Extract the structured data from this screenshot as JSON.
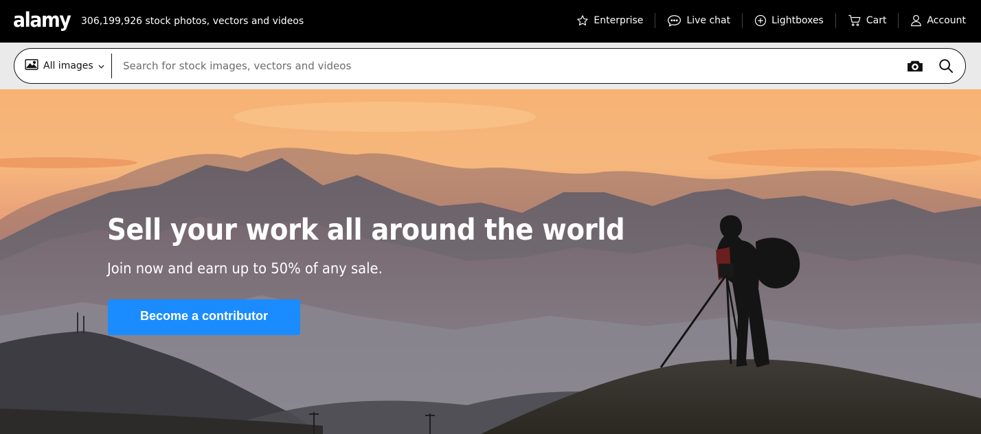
{
  "brand": {
    "logo_text": "alamy",
    "tagline": "306,199,926 stock photos, vectors and videos"
  },
  "topnav": {
    "items": [
      {
        "label": "Enterprise",
        "icon": "star-icon"
      },
      {
        "label": "Live chat",
        "icon": "chat-bubble-icon"
      },
      {
        "label": "Lightboxes",
        "icon": "plus-circle-icon"
      },
      {
        "label": "Cart",
        "icon": "cart-icon"
      },
      {
        "label": "Account",
        "icon": "user-icon"
      }
    ]
  },
  "search": {
    "type_label": "All images",
    "type_icon": "image-icon",
    "placeholder": "Search for stock images, vectors and videos",
    "value": "",
    "camera_icon": "camera-search-icon",
    "search_icon": "magnifier-icon"
  },
  "hero": {
    "title": "Sell your work all around the world",
    "subtitle": "Join now and earn up to 50% of any sale.",
    "cta_label": "Become a contributor"
  },
  "colors": {
    "topbar_bg": "#000000",
    "strip_bg": "#eaeaea",
    "cta_bg": "#1a8cff",
    "sky_top": "#f6b06e",
    "mountains": "#6e6168"
  }
}
